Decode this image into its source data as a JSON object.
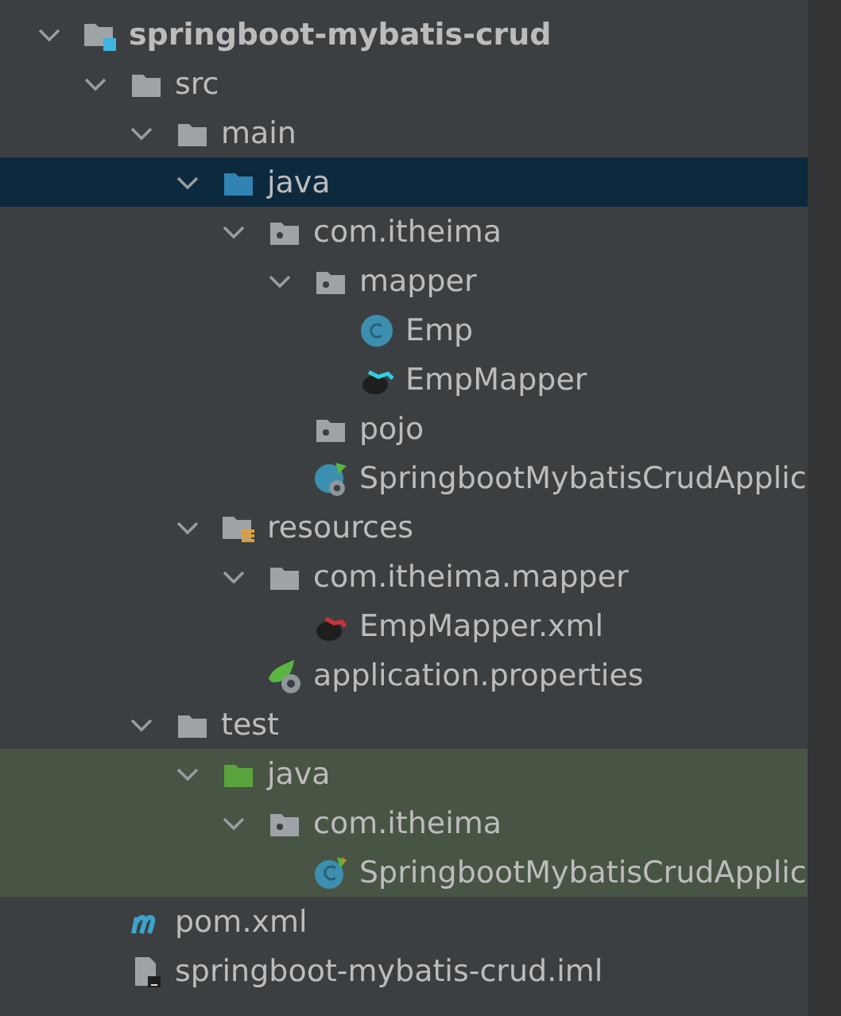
{
  "project_tree": [
    {
      "label": "springboot-mybatis-crud",
      "kind": "project",
      "expanded": true,
      "selected": false,
      "test_scope": false,
      "children": [
        {
          "label": "src",
          "kind": "folder",
          "expanded": true,
          "selected": false,
          "test_scope": false,
          "children": [
            {
              "label": "main",
              "kind": "folder",
              "expanded": true,
              "selected": false,
              "test_scope": false,
              "children": [
                {
                  "label": "java",
                  "kind": "source-folder",
                  "expanded": true,
                  "selected": true,
                  "test_scope": false,
                  "children": [
                    {
                      "label": "com.itheima",
                      "kind": "package",
                      "expanded": true,
                      "selected": false,
                      "test_scope": false,
                      "children": [
                        {
                          "label": "mapper",
                          "kind": "package",
                          "expanded": true,
                          "selected": false,
                          "test_scope": false,
                          "children": [
                            {
                              "label": "Emp",
                              "kind": "class",
                              "selected": false,
                              "test_scope": false
                            },
                            {
                              "label": "EmpMapper",
                              "kind": "mapper-interface",
                              "selected": false,
                              "test_scope": false
                            }
                          ]
                        },
                        {
                          "label": "pojo",
                          "kind": "package",
                          "selected": false,
                          "test_scope": false
                        },
                        {
                          "label": "SpringbootMybatisCrudApplic",
                          "kind": "spring-class",
                          "selected": false,
                          "test_scope": false
                        }
                      ]
                    }
                  ]
                },
                {
                  "label": "resources",
                  "kind": "resources-folder",
                  "expanded": true,
                  "selected": false,
                  "test_scope": false,
                  "children": [
                    {
                      "label": "com.itheima.mapper",
                      "kind": "folder",
                      "expanded": true,
                      "selected": false,
                      "test_scope": false,
                      "children": [
                        {
                          "label": "EmpMapper.xml",
                          "kind": "mapper-xml",
                          "selected": false,
                          "test_scope": false
                        }
                      ]
                    },
                    {
                      "label": "application.properties",
                      "kind": "spring-properties",
                      "selected": false,
                      "test_scope": false
                    }
                  ]
                }
              ]
            },
            {
              "label": "test",
              "kind": "folder",
              "expanded": true,
              "selected": false,
              "test_scope": false,
              "children": [
                {
                  "label": "java",
                  "kind": "test-folder",
                  "expanded": true,
                  "selected": false,
                  "test_scope": true,
                  "children": [
                    {
                      "label": "com.itheima",
                      "kind": "package",
                      "expanded": true,
                      "selected": false,
                      "test_scope": true,
                      "children": [
                        {
                          "label": "SpringbootMybatisCrudApplic",
                          "kind": "test-class",
                          "selected": false,
                          "test_scope": true
                        }
                      ]
                    }
                  ]
                }
              ]
            }
          ]
        },
        {
          "label": "pom.xml",
          "kind": "maven",
          "selected": false,
          "test_scope": false
        },
        {
          "label": "springboot-mybatis-crud.iml",
          "kind": "iml",
          "selected": false,
          "test_scope": false
        }
      ]
    }
  ]
}
